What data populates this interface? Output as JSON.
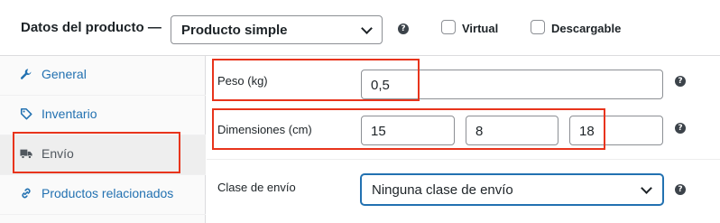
{
  "header": {
    "title": "Datos del producto —",
    "product_type": "Producto simple",
    "help": "?",
    "virtual_label": "Virtual",
    "virtual_checked": false,
    "downloadable_label": "Descargable",
    "downloadable_checked": false
  },
  "sidebar": {
    "items": [
      {
        "label": "General",
        "icon": "wrench-icon",
        "active": false
      },
      {
        "label": "Inventario",
        "icon": "tag-icon",
        "active": false
      },
      {
        "label": "Envío",
        "icon": "truck-icon",
        "active": true
      },
      {
        "label": "Productos relacionados",
        "icon": "link-icon",
        "active": false
      }
    ]
  },
  "shipping": {
    "weight_label": "Peso (kg)",
    "weight_value": "0,5",
    "dimensions_label": "Dimensiones (cm)",
    "length_value": "15",
    "width_value": "8",
    "height_value": "18",
    "class_label": "Clase de envío",
    "class_value": "Ninguna clase de envío",
    "help": "?"
  },
  "colors": {
    "link": "#2271b1",
    "highlight": "#e8341c",
    "focus_border": "#2271b1"
  }
}
